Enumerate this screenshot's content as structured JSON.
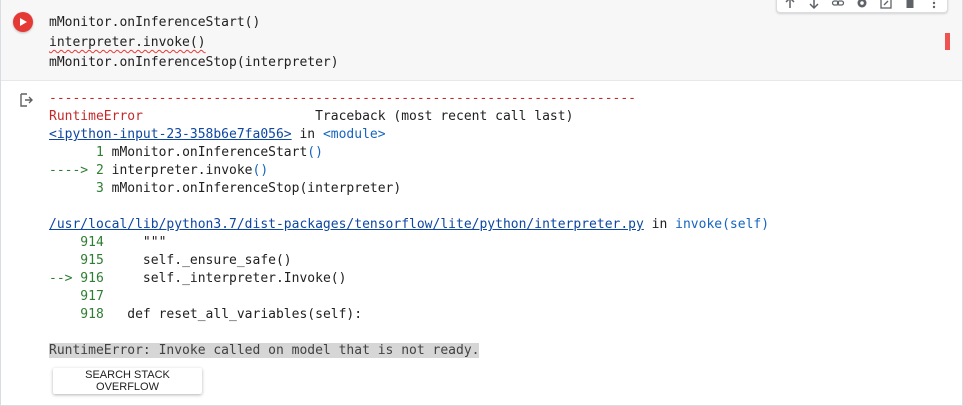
{
  "toolbar": {
    "icons": [
      "arrow-up-icon",
      "arrow-down-icon",
      "link-icon",
      "gear-icon",
      "mirror-cell-icon",
      "delete-icon",
      "more-vert-icon"
    ]
  },
  "code": {
    "lines": [
      "mMonitor.onInferenceStart()",
      "interpreter.invoke()",
      "mMonitor.onInferenceStop(interpreter)"
    ]
  },
  "output": {
    "separator": "---------------------------------------------------------------------------",
    "error_name": "RuntimeError",
    "traceback_header": "Traceback (most recent call last)",
    "frame1": {
      "file": "<ipython-input-23-358b6e7fa056>",
      "in_word": "in",
      "func": "<module>",
      "lines": [
        {
          "marker": "      1 ",
          "code": "mMonitor.onInferenceStart",
          "suffix": "()"
        },
        {
          "marker": "----> 2 ",
          "code": "interpreter.invoke",
          "suffix": "()"
        },
        {
          "marker": "      3 ",
          "code": "mMonitor.onInferenceStop",
          "suffix": "(interpreter)"
        }
      ]
    },
    "frame2": {
      "file": "/usr/local/lib/python3.7/dist-packages/tensorflow/lite/python/interpreter.py",
      "in_word": "in",
      "func": "invoke(self)",
      "lines": [
        {
          "marker": "    914 ",
          "code": "    \"\"\""
        },
        {
          "marker": "    915 ",
          "code": "    self._ensure_safe()"
        },
        {
          "marker": "--> 916 ",
          "code": "    self._interpreter.Invoke()"
        },
        {
          "marker": "    917 ",
          "code": ""
        },
        {
          "marker": "    918 ",
          "code": "  def reset_all_variables(self):"
        }
      ]
    },
    "final_error": "RuntimeError: Invoke called on model that is not ready."
  },
  "search_button_label": "SEARCH STACK OVERFLOW"
}
